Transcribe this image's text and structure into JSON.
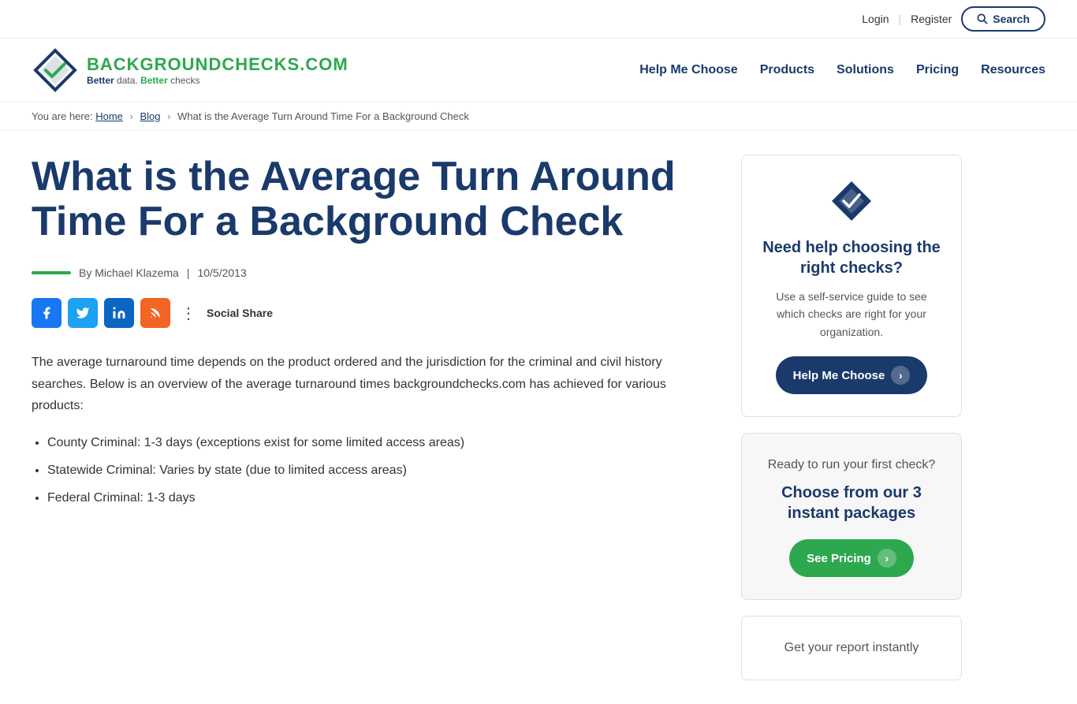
{
  "topbar": {
    "login_label": "Login",
    "separator": "|",
    "register_label": "Register",
    "search_label": "Search"
  },
  "header": {
    "brand_part1": "BACKGROUND",
    "brand_part2": "CHECKS.COM",
    "tagline_part1": "Better",
    "tagline_word1": "data.",
    "tagline_part2": "Better",
    "tagline_word2": "checks"
  },
  "nav": {
    "items": [
      {
        "label": "Help Me Choose",
        "id": "help-me-choose"
      },
      {
        "label": "Products",
        "id": "products"
      },
      {
        "label": "Solutions",
        "id": "solutions"
      },
      {
        "label": "Pricing",
        "id": "pricing"
      },
      {
        "label": "Resources",
        "id": "resources"
      }
    ]
  },
  "breadcrumb": {
    "prefix": "You are here:",
    "home": "Home",
    "blog": "Blog",
    "current": "What is the Average Turn Around Time For a Background Check"
  },
  "article": {
    "title": "What is the Average Turn Around Time For a Background Check",
    "meta_author": "By Michael Klazema",
    "meta_date": "10/5/2013",
    "body_paragraph": "The average turnaround time depends on the product ordered and the jurisdiction for the criminal and civil history searches. Below is an overview of the average turnaround times backgroundchecks.com has achieved for various products:",
    "list_items": [
      "County Criminal: 1-3 days (exceptions exist for some limited access areas)",
      "Statewide Criminal: Varies by state (due to limited access areas)",
      "Federal Criminal: 1-3 days"
    ]
  },
  "social": {
    "label": "Social Share"
  },
  "sidebar": {
    "card1": {
      "title": "Need help choosing the right checks?",
      "desc": "Use a self-service guide to see which checks are right for your organization.",
      "btn_label": "Help Me Choose"
    },
    "card2": {
      "pre_title": "Ready to run your first check?",
      "title": "Choose from our 3 instant packages",
      "btn_label": "See Pricing"
    },
    "card3": {
      "title": "Get your report instantly"
    }
  }
}
